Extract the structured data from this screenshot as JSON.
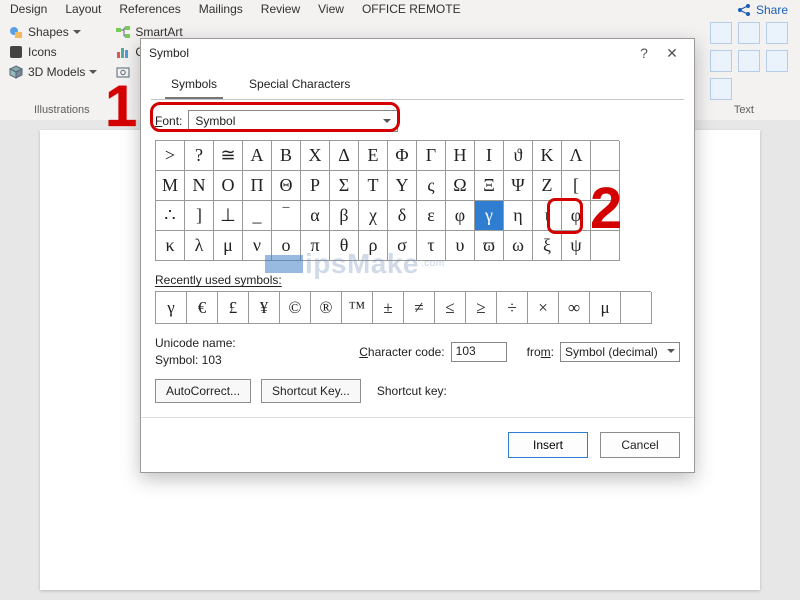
{
  "ribbon": {
    "tabs": [
      "Design",
      "Layout",
      "References",
      "Mailings",
      "Review",
      "View",
      "OFFICE REMOTE"
    ],
    "share_label": "Share",
    "items": {
      "shapes": "Shapes",
      "icons": "Icons",
      "models": "3D Models",
      "smartart": "SmartArt",
      "chart": "Chart"
    },
    "group_illustrations": "Illustrations",
    "group_text": "Text"
  },
  "dialog": {
    "title": "Symbol",
    "tabs": {
      "symbols": "Symbols",
      "special": "Special Characters"
    },
    "font_label": "Font:",
    "font_value": "Symbol",
    "grid": {
      "rows": [
        [
          ">",
          "?",
          "≅",
          "Α",
          "Β",
          "Χ",
          "Δ",
          "Ε",
          "Φ",
          "Γ",
          "Η",
          "Ι",
          "ϑ",
          "Κ",
          "Λ",
          ""
        ],
        [
          "Μ",
          "Ν",
          "Ο",
          "Π",
          "Θ",
          "Ρ",
          "Σ",
          "Τ",
          "Υ",
          "ς",
          "Ω",
          "Ξ",
          "Ψ",
          "Ζ",
          "[",
          ""
        ],
        [
          "∴",
          "]",
          "⊥",
          "_",
          "‾",
          "α",
          "β",
          "χ",
          "δ",
          "ε",
          "φ",
          "γ",
          "η",
          "ι",
          "φ",
          ""
        ],
        [
          "κ",
          "λ",
          "μ",
          "ν",
          "ο",
          "π",
          "θ",
          "ρ",
          "σ",
          "τ",
          "υ",
          "ϖ",
          "ω",
          "ξ",
          "ψ",
          ""
        ]
      ],
      "selected": {
        "row": 2,
        "col": 11
      }
    },
    "recent_label": "Recently used symbols:",
    "recent": [
      "γ",
      "€",
      "£",
      "¥",
      "©",
      "®",
      "™",
      "±",
      "≠",
      "≤",
      "≥",
      "÷",
      "×",
      "∞",
      "μ",
      ""
    ],
    "unicode_name_label": "Unicode name:",
    "unicode_name_value": "Symbol: 103",
    "char_code_label": "Character code:",
    "char_code_value": "103",
    "from_label": "from:",
    "from_value": "Symbol (decimal)",
    "autocorrect": "AutoCorrect...",
    "shortcut_key_btn": "Shortcut Key...",
    "shortcut_key_label": "Shortcut key:",
    "insert": "Insert",
    "cancel": "Cancel"
  },
  "annotations": {
    "one": "1",
    "two": "2"
  },
  "watermark": {
    "text": "ipsMake",
    "sub": ".com"
  }
}
